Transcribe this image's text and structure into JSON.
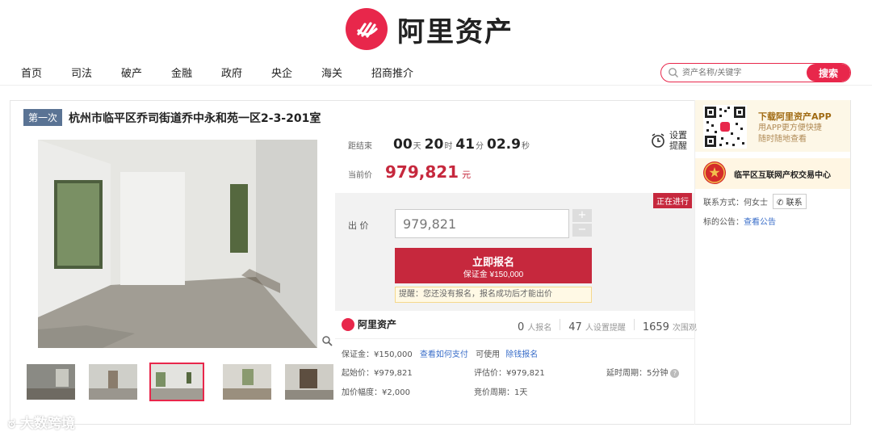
{
  "brand": {
    "name": "阿里资产"
  },
  "nav": {
    "items": [
      "首页",
      "司法",
      "破产",
      "金融",
      "政府",
      "央企",
      "海关",
      "招商推介"
    ]
  },
  "search": {
    "placeholder": "资产名称/关键字",
    "button": "搜索"
  },
  "item": {
    "round": "第一次",
    "title": "杭州市临平区乔司街道乔中永和苑一区2-3-201室"
  },
  "countdown": {
    "label": "距结束",
    "days": "00",
    "day_unit": "天",
    "hours": "20",
    "hour_unit": "时",
    "minutes": "41",
    "minute_unit": "分",
    "seconds": "02.9",
    "second_unit": "秒"
  },
  "remind": {
    "line1": "设置",
    "line2": "提醒"
  },
  "current_price": {
    "label": "当前价",
    "value": "979,821",
    "unit": "元"
  },
  "status": "正在进行",
  "bid": {
    "label": "出 价",
    "value": "979,821",
    "plus": "+",
    "minus": "−"
  },
  "signup": {
    "label": "立即报名",
    "deposit": "保证金 ¥150,000"
  },
  "hint": "提醒：您还没有报名，报名成功后才能出价",
  "stats": {
    "signups": "0",
    "signups_label": "人报名",
    "reminders": "47",
    "reminders_label": "人设置提醒",
    "views": "1659",
    "views_label": "次围观"
  },
  "details": {
    "deposit_label": "保证金：¥150,000",
    "how_to_pay": "查看如何支付",
    "usable_label": "可使用",
    "usable_link": "除钱报名",
    "start_price": "起始价：¥979,821",
    "eval_price": "评估价：¥979,821",
    "delay": "延时周期：5分钟",
    "increment": "加价幅度：¥2,000",
    "bid_period": "竞价周期：1天"
  },
  "app": {
    "title": "下载阿里资产APP",
    "desc1": "用APP更方便快捷",
    "desc2": "随时随地查看"
  },
  "org": {
    "name": "临平区互联网产权交易中心"
  },
  "contact": {
    "label": "联系方式：何女士",
    "button": "联系"
  },
  "notice": {
    "label": "标的公告：",
    "link": "查看公告"
  },
  "watermark": "大数跨境",
  "colors": {
    "brand_red": "#e8274b",
    "price_red": "#c6283d",
    "tag_blue": "#5a7394"
  }
}
